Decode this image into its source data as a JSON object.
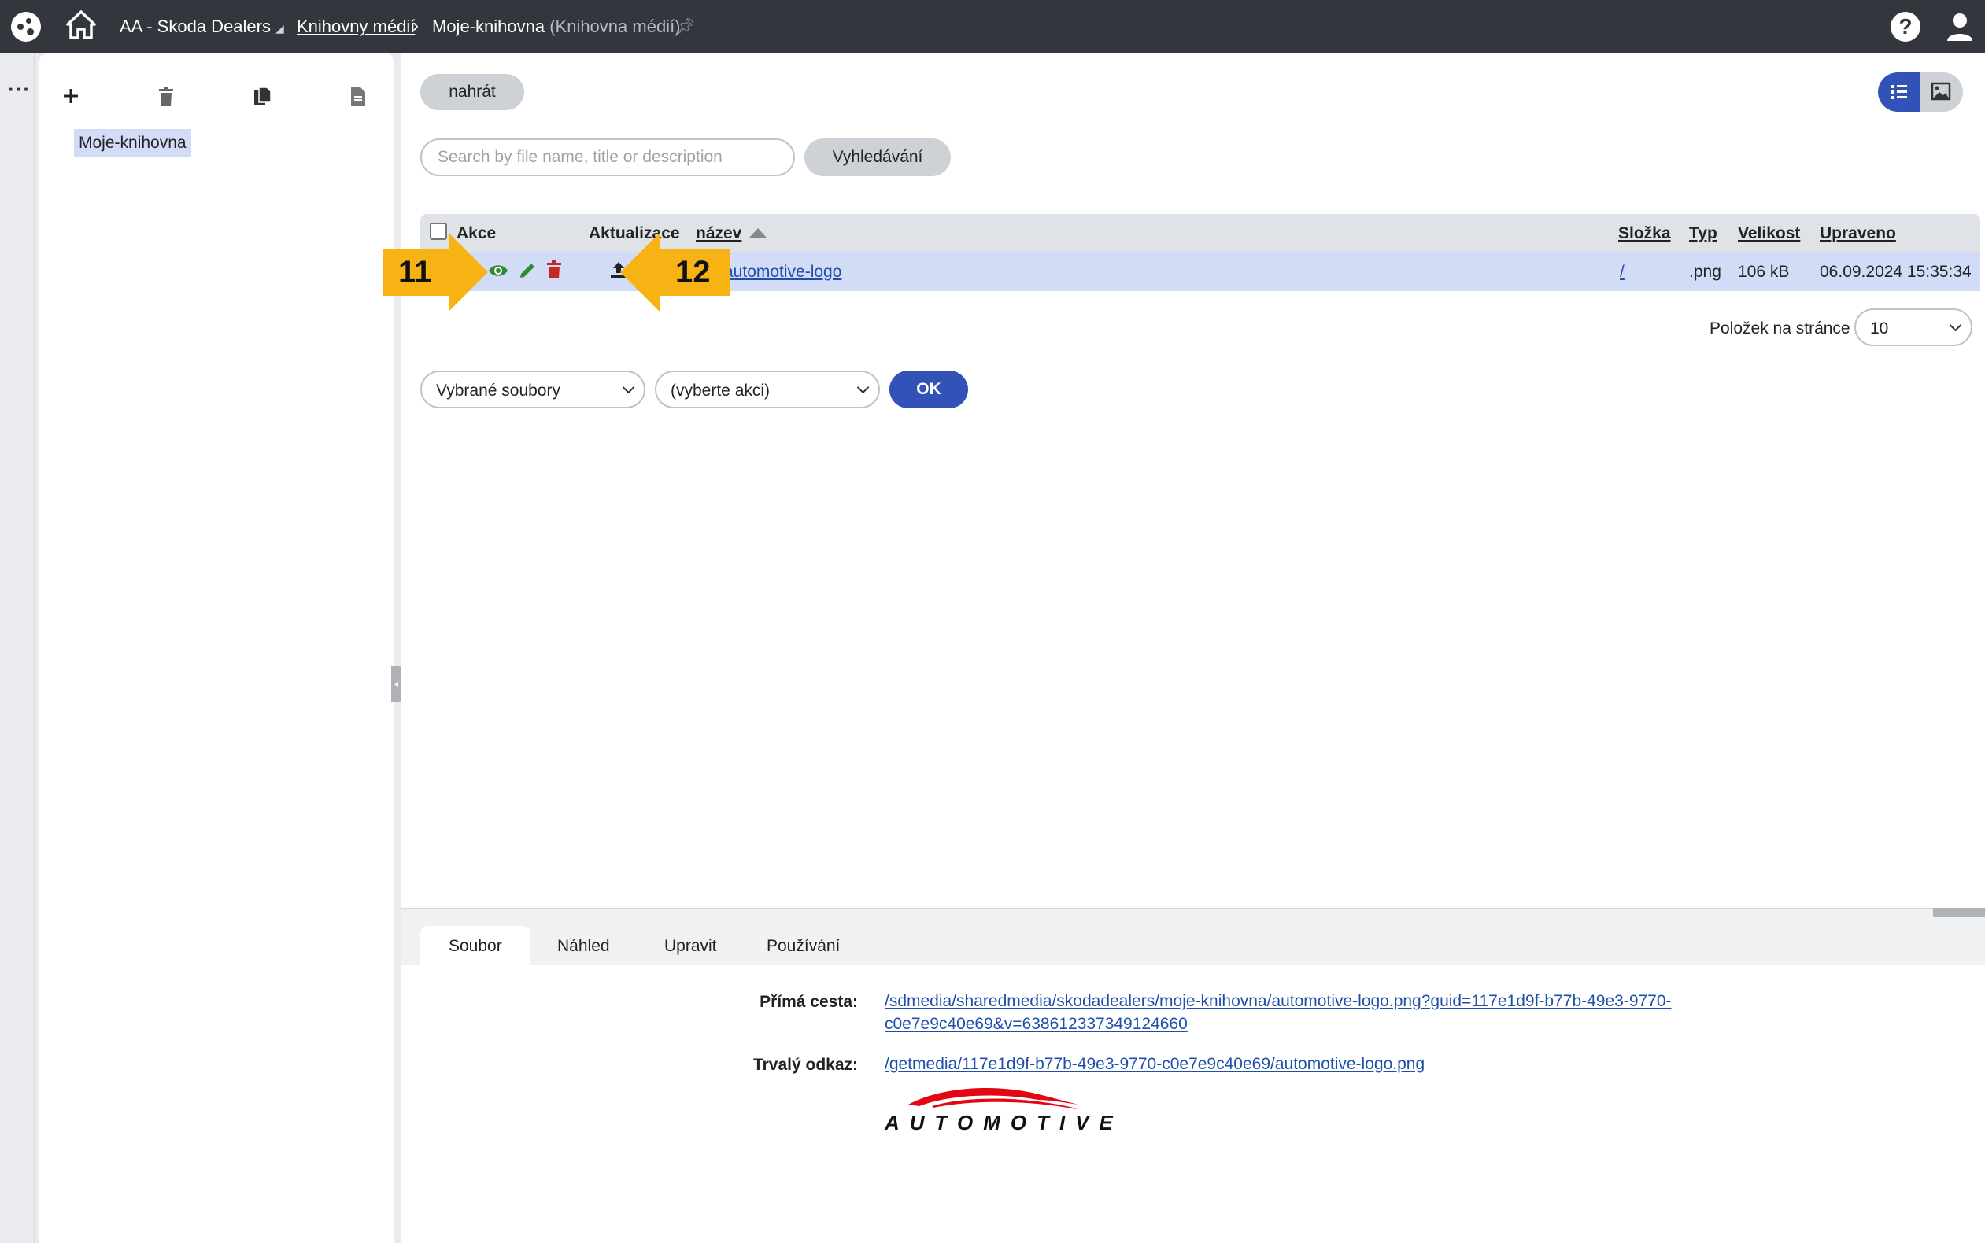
{
  "topbar": {
    "site_name": "AA - Skoda Dealers",
    "breadcrumb_parent": "Knihovny médií",
    "breadcrumb_current": "Moje-knihovna",
    "breadcrumb_current_suffix": "(Knihovna médií)",
    "help_label": "?"
  },
  "tree": {
    "node_label": "Moje-knihovna"
  },
  "main": {
    "upload_label": "nahrát",
    "search_placeholder": "Search by file name, title or description",
    "search_button": "Vyhledávání",
    "columns": {
      "actions": "Akce",
      "update": "Aktualizace",
      "name": "název",
      "folder": "Složka",
      "type": "Typ",
      "size": "Velikost",
      "modified": "Upraveno"
    },
    "rows": [
      {
        "name": "automotive-logo",
        "folder": "/",
        "type": ".png",
        "size": "106 kB",
        "modified": "06.09.2024 15:35:34"
      }
    ],
    "callout_left": "11",
    "callout_right": "12",
    "page_size_label": "Položek na stránce",
    "page_size_value": "10",
    "bulk_scope": "Vybrané soubory",
    "bulk_action": "(vyberte akci)",
    "ok_label": "OK"
  },
  "bottom": {
    "tabs": [
      "Soubor",
      "Náhled",
      "Upravit",
      "Používání"
    ],
    "direct_path_label": "Přímá cesta:",
    "direct_path_line1": "/sdmedia/sharedmedia/skodadealers/moje-knihovna/automotive-logo.png?guid=117e1d9f-b77b-49e3-9770-",
    "direct_path_line2": "c0e7e9c40e69&v=638612337349124660",
    "permalink_label": "Trvalý odkaz:",
    "permalink_value": "/getmedia/117e1d9f-b77b-49e3-9770-c0e7e9c40e69/automotive-logo.png",
    "preview_logo_text": "AUTOMOTIVE"
  },
  "colors": {
    "topbar": "#33363c",
    "accent_blue": "#3352b8",
    "row_selected": "#d3dcf7",
    "callout": "#f7b314",
    "view_icon": "#2e8b2e",
    "delete_icon": "#c62828",
    "logo_red": "#e30613"
  },
  "icons": [
    "app-logo-icon",
    "home-icon",
    "pin-icon",
    "help-icon",
    "user-icon",
    "more-icon",
    "add-icon",
    "trash-icon",
    "copy-icon",
    "document-icon",
    "list-view-icon",
    "image-view-icon",
    "view-eye-icon",
    "edit-pencil-icon",
    "delete-icon",
    "upload-icon",
    "chevron-down-icon"
  ]
}
